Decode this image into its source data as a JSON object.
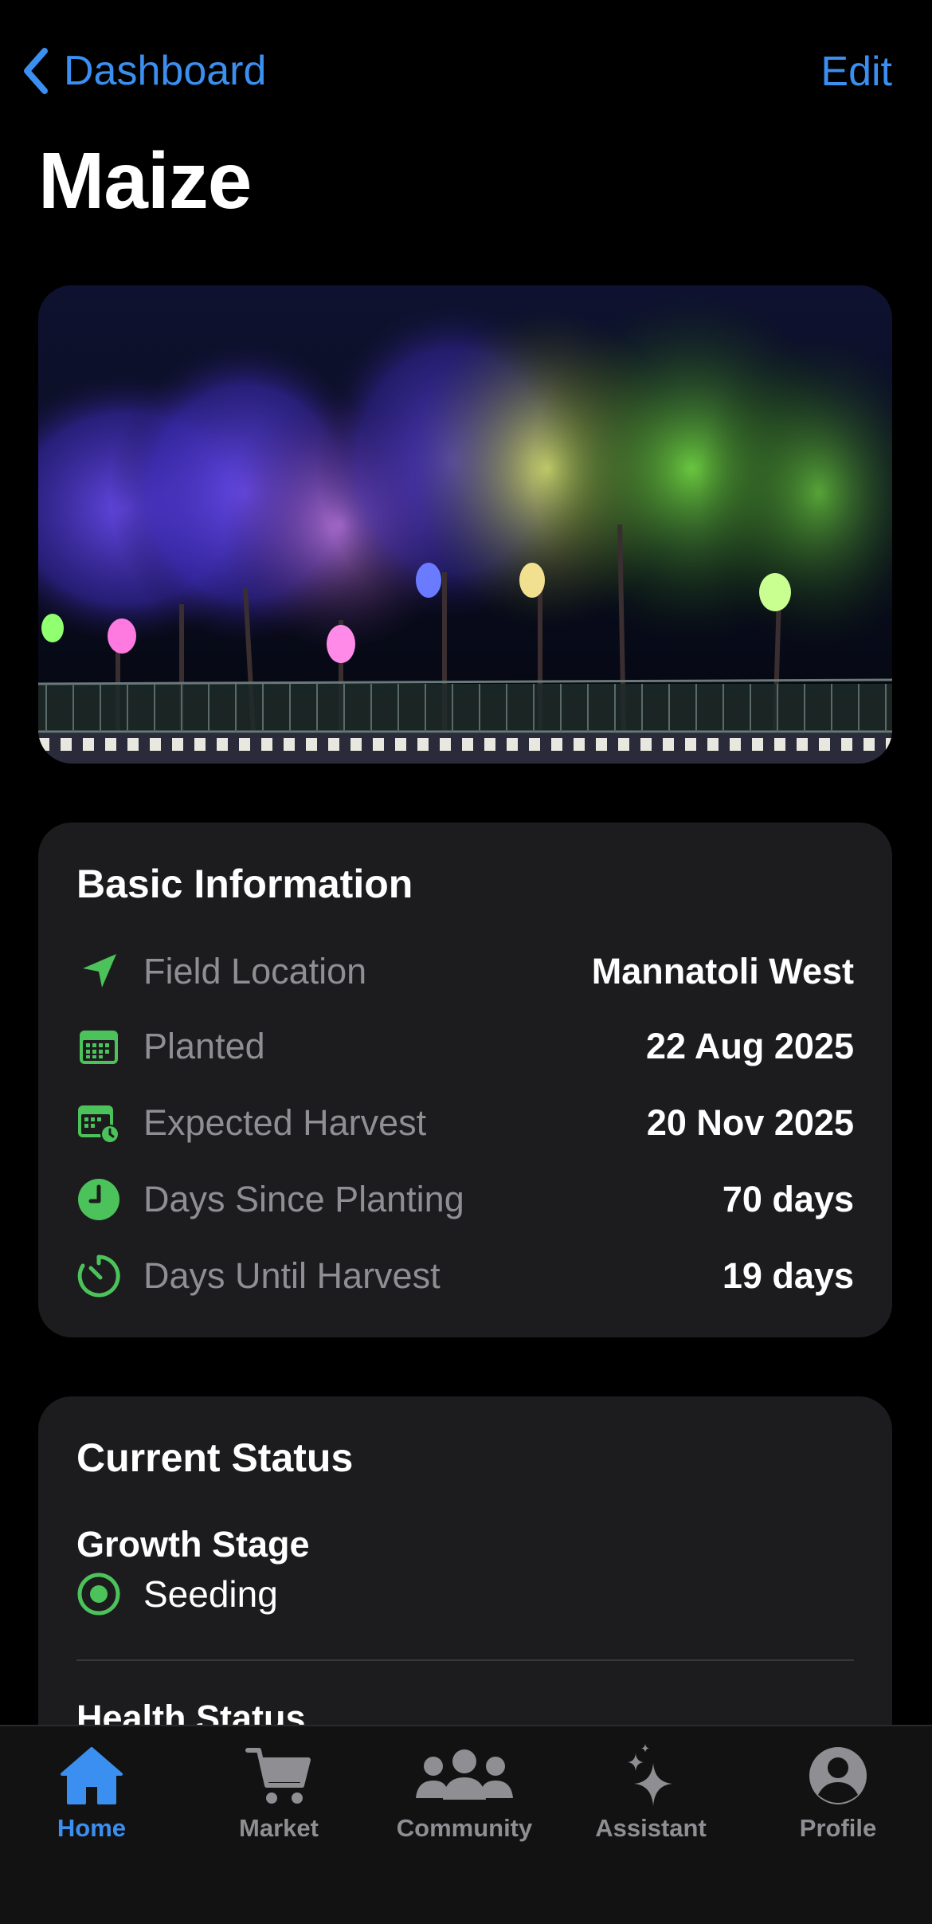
{
  "nav": {
    "back_label": "Dashboard",
    "edit_label": "Edit"
  },
  "page_title": "Maize",
  "basic_info": {
    "title": "Basic Information",
    "rows": [
      {
        "icon": "location-arrow-icon",
        "label": "Field Location",
        "value": "Mannatoli West"
      },
      {
        "icon": "calendar-icon",
        "label": "Planted",
        "value": "22 Aug 2025"
      },
      {
        "icon": "calendar-clock-icon",
        "label": "Expected Harvest",
        "value": "20 Nov 2025"
      },
      {
        "icon": "clock-icon",
        "label": "Days Since Planting",
        "value": "70 days"
      },
      {
        "icon": "timer-icon",
        "label": "Days Until Harvest",
        "value": "19 days"
      }
    ]
  },
  "current_status": {
    "title": "Current Status",
    "growth_stage_label": "Growth Stage",
    "growth_stage_value": "Seeding",
    "health_status_label": "Health Status"
  },
  "tabs": [
    {
      "label": "Home",
      "icon": "house-icon",
      "active": true
    },
    {
      "label": "Market",
      "icon": "cart-icon",
      "active": false
    },
    {
      "label": "Community",
      "icon": "people-icon",
      "active": false
    },
    {
      "label": "Assistant",
      "icon": "sparkles-icon",
      "active": false
    },
    {
      "label": "Profile",
      "icon": "person-circle-icon",
      "active": false
    }
  ],
  "colors": {
    "accent": "#3b8ff0",
    "icon_green": "#4cc35a",
    "card_bg": "#1c1c1e",
    "secondary_text": "#8e8e93"
  }
}
